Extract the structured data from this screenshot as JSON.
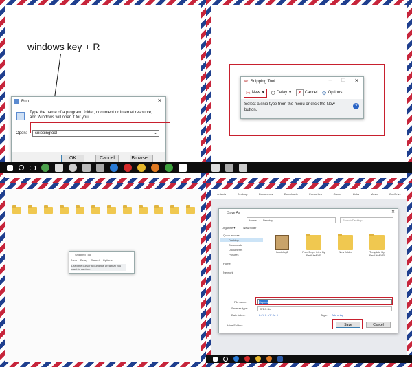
{
  "p1": {
    "caption": "windows key + R",
    "run": {
      "title": "Run",
      "description": "Type the name of a program, folder, document or Internet resource, and Windows will open it for you.",
      "open_label": "Open:",
      "open_value": "snippingtool",
      "ok": "OK",
      "cancel": "Cancel",
      "browse": "Browse..."
    }
  },
  "p2": {
    "snip": {
      "title": "Snipping Tool",
      "new": "New",
      "delay": "Delay",
      "cancel": "Cancel",
      "options": "Options",
      "message": "Select a snip type from the menu or click the New button."
    }
  },
  "p3": {
    "snip": {
      "title": "Snipping Tool",
      "new": "New",
      "delay": "Delay",
      "cancel": "Cancel",
      "options": "Options",
      "message": "Drag the cursor around the area that you want to capture."
    }
  },
  "p4": {
    "toolbar_items": [
      "ontacts",
      "Desktop",
      "Documents",
      "Downloads",
      "Favourites",
      "Gamel",
      "Links",
      "Music",
      "OneDrive"
    ],
    "saveas": {
      "title": "Save As",
      "path": [
        "Home",
        "Desktop"
      ],
      "search_placeholder": "Search Desktop",
      "organise": "Organise ▾",
      "new_folder": "New folder",
      "nav": [
        "Quick access",
        "Desktop",
        "Downloads",
        "Documents",
        "Pictures",
        "Home",
        "Network"
      ],
      "files": [
        "bestblog2",
        "Free Dope intro By RedLiteRVP",
        "New folder",
        "Template By RedLiteRVP"
      ],
      "file_name_label": "File name:",
      "file_name_value": "Capture",
      "save_type_label": "Save as type:",
      "save_type_value": "JPEG file",
      "date_label": "Date taken:",
      "date_value": "٢٠١٩/٠٨/٠٤ ٥:٤٢",
      "tags_label": "Tags:",
      "tags_value": "Add a tag",
      "hide_folders": "Hide Folders",
      "save": "Save",
      "cancel": "Cancel"
    }
  },
  "colors": {
    "accent": "#c8202e",
    "taskbar": "#0e0e0e",
    "stripe_red": "#c7253b",
    "stripe_blue": "#1f3f8f"
  }
}
